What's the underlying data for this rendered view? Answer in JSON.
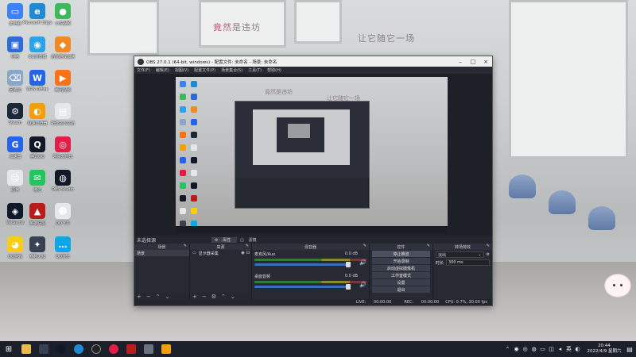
{
  "wallpaper": {
    "text_left_accent": "竟然",
    "text_left_rest": "是违坊",
    "text_right": "让它随它一场"
  },
  "desktop_icons": [
    {
      "label": "此电脑",
      "icon": "computer-icon",
      "color": "#3b82f6",
      "glyph": "▭"
    },
    {
      "label": "Microsoft Edge",
      "icon": "browser-icon",
      "color": "#1f8ad3",
      "glyph": "e"
    },
    {
      "label": "小优视频",
      "icon": "video-app-icon",
      "color": "#3db85b",
      "glyph": "●"
    },
    {
      "label": "网络",
      "icon": "network-icon",
      "color": "#2f6bd6",
      "glyph": "▣"
    },
    {
      "label": "QQ浏览器",
      "icon": "qq-browser-icon",
      "color": "#2aa3e8",
      "glyph": "◉"
    },
    {
      "label": "迅雷游戏加速",
      "icon": "game-booster-icon",
      "color": "#f08a24",
      "glyph": "◆"
    },
    {
      "label": "回收站",
      "icon": "recycle-bin-icon",
      "color": "#8aa7c9",
      "glyph": "⌫"
    },
    {
      "label": "WPS Office",
      "icon": "wps-icon",
      "color": "#2563eb",
      "glyph": "W"
    },
    {
      "label": "腾讯视频",
      "icon": "tencent-video-icon",
      "color": "#f97316",
      "glyph": "▶"
    },
    {
      "label": "Steam",
      "icon": "steam-icon",
      "color": "#1b2838",
      "glyph": "⚙"
    },
    {
      "label": "极速浏览器",
      "icon": "speed-browser-icon",
      "color": "#f59e0b",
      "glyph": "◐"
    },
    {
      "label": "新建文本文档",
      "icon": "text-file-icon",
      "color": "#e5e7eb",
      "glyph": "▤"
    },
    {
      "label": "加速器",
      "icon": "accelerator-icon",
      "color": "#2563eb",
      "glyph": "G"
    },
    {
      "label": "腾讯QQ",
      "icon": "qq-icon",
      "color": "#111827",
      "glyph": "Q"
    },
    {
      "label": "网易云音乐",
      "icon": "netease-music-icon",
      "color": "#e11d48",
      "glyph": "◎"
    },
    {
      "label": "原神",
      "icon": "game-character-icon",
      "color": "#e5e7eb",
      "glyph": "☺"
    },
    {
      "label": "微信",
      "icon": "wechat-icon",
      "color": "#22c55e",
      "glyph": "✉"
    },
    {
      "label": "OBS Studio",
      "icon": "obs-icon",
      "color": "#111827",
      "glyph": "◍"
    },
    {
      "label": "WeGame",
      "icon": "wegame-icon",
      "color": "#111827",
      "glyph": "◈"
    },
    {
      "label": "英雄联盟",
      "icon": "league-icon",
      "color": "#b91c1c",
      "glyph": "▲"
    },
    {
      "label": "QQ飞车",
      "icon": "game-car-icon",
      "color": "#e5e7eb",
      "glyph": "☻"
    },
    {
      "label": "QQ游戏",
      "icon": "qq-game-icon",
      "color": "#facc15",
      "glyph": "◕"
    },
    {
      "label": "穿越火线",
      "icon": "cf-game-icon",
      "color": "#374151",
      "glyph": "✦"
    },
    {
      "label": "QQ音乐",
      "icon": "chat-bubble-icon",
      "color": "#0ea5e9",
      "glyph": "…"
    }
  ],
  "obs": {
    "title": "OBS 27.0.1 (64-bit, windows) - 配置文件: 未命名 - 场景: 未命名",
    "menu": [
      "文件(F)",
      "编辑(E)",
      "视图(V)",
      "配置文件(P)",
      "场景集合(S)",
      "工具(T)",
      "帮助(H)"
    ],
    "preview_text_left": "竟然是违坊",
    "preview_text_right": "让它随它一场",
    "scene_bar_label": "未选择源",
    "tabs": [
      "属性",
      "滤镜"
    ],
    "docks": {
      "scenes": {
        "title": "场景",
        "items": [
          "场景"
        ]
      },
      "sources": {
        "title": "来源",
        "items": [
          "显示器采集"
        ]
      },
      "mixer": {
        "title": "混音器",
        "channels": [
          {
            "name": "麦克风/Aux",
            "value": "0.0 dB"
          },
          {
            "name": "桌面音频",
            "value": "0.0 dB"
          }
        ]
      },
      "transitions": {
        "title": "转场特效",
        "type": "淡出",
        "duration_label": "时长",
        "duration": "300 ms"
      },
      "controls": {
        "title": "控件",
        "buttons": [
          "停止推流",
          "开始录制",
          "启动虚拟摄像机",
          "工作室模式",
          "设置",
          "退出"
        ]
      }
    },
    "status": {
      "live_label": "LIVE:",
      "live_time": "00:00:00",
      "rec_label": "REC:",
      "rec_time": "00:00:00",
      "cpu": "CPU: 0.7%, 30.00 fps"
    }
  },
  "taskbar": {
    "clock_time": "20:44",
    "clock_date": "2022/4/9 星期六"
  }
}
